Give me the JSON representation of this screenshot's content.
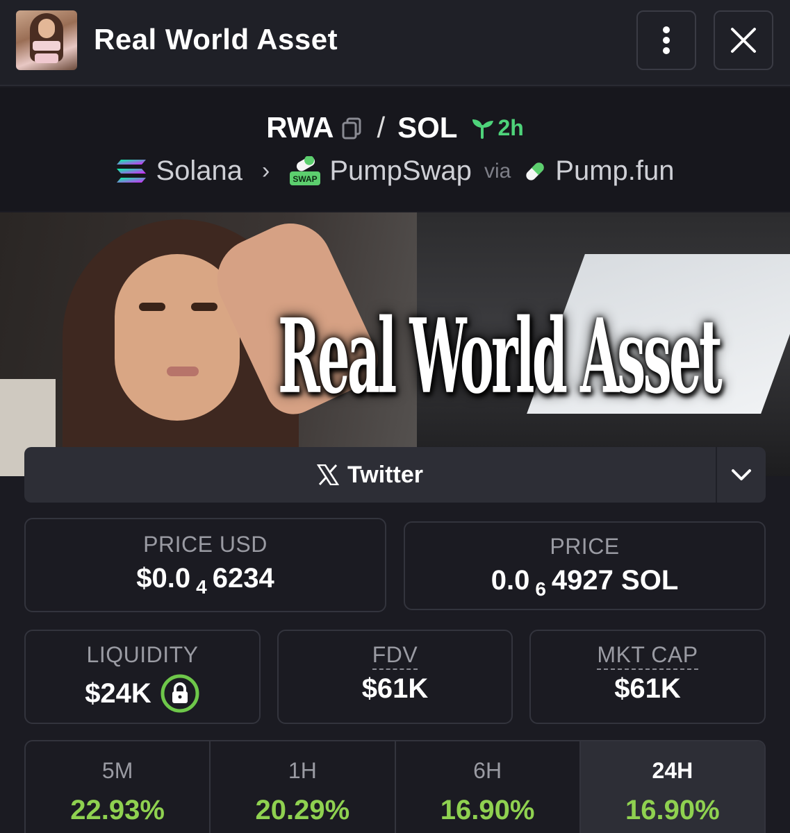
{
  "header": {
    "title": "Real World Asset"
  },
  "pair": {
    "base": "RWA",
    "separator": "/",
    "quote": "SOL",
    "age": "2h",
    "chain": "Solana",
    "dex": "PumpSwap",
    "dex_badge": "SWAP",
    "via": "via",
    "launchpad": "Pump.fun"
  },
  "banner": {
    "text": "Real World Asset"
  },
  "social": {
    "twitter_label": "Twitter"
  },
  "stats": {
    "price_usd_label": "PRICE USD",
    "price_usd_prefix": "$0.0",
    "price_usd_zeros": "4",
    "price_usd_digits": "6234",
    "price_label": "PRICE",
    "price_prefix": "0.0",
    "price_zeros": "6",
    "price_digits": "4927 SOL",
    "liquidity_label": "LIQUIDITY",
    "liquidity_value": "$24K",
    "fdv_label": "FDV",
    "fdv_value": "$61K",
    "mktcap_label": "MKT CAP",
    "mktcap_value": "$61K"
  },
  "timeframes": [
    {
      "label": "5M",
      "change": "22.93%"
    },
    {
      "label": "1H",
      "change": "20.29%"
    },
    {
      "label": "6H",
      "change": "16.90%"
    },
    {
      "label": "24H",
      "change": "16.90%"
    }
  ],
  "colors": {
    "positive": "#8fd150",
    "age_green": "#4ed37a",
    "lock_ring": "#6ec74a"
  }
}
